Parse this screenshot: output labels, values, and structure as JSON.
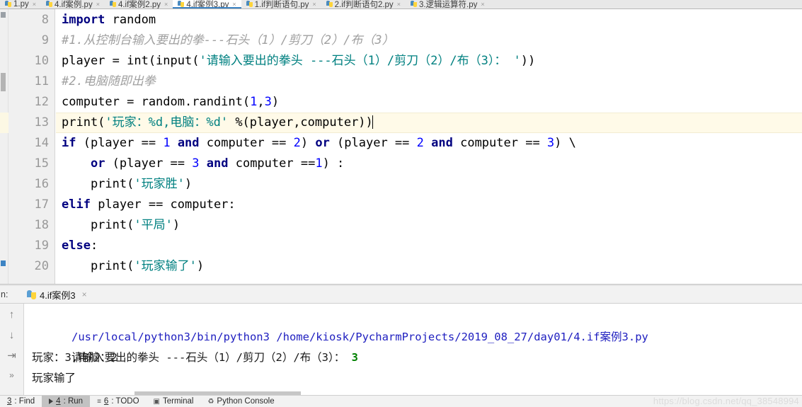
{
  "editor_tabs": [
    {
      "label": "1.py",
      "active": false
    },
    {
      "label": "4.if案例.py",
      "active": false
    },
    {
      "label": "4.if案例2.py",
      "active": false
    },
    {
      "label": "4.if案例3.py",
      "active": true
    },
    {
      "label": "1.if判断语句.py",
      "active": false
    },
    {
      "label": "2.if判断语句2.py",
      "active": false
    },
    {
      "label": "3.逻辑运算符.py",
      "active": false
    }
  ],
  "editor": {
    "first_line_number": 8,
    "current_line": 13,
    "lines": [
      {
        "n": "8",
        "text": "import random"
      },
      {
        "n": "9",
        "text": "#1.从控制台输入要出的拳---石头（1）/剪刀（2）/布（3）"
      },
      {
        "n": "10",
        "text": "player = int(input('请输入要出的拳头 ---石头（1）/剪刀（2）/布（3）： '))"
      },
      {
        "n": "11",
        "text": "#2.电脑随即出拳"
      },
      {
        "n": "12",
        "text": "computer = random.randint(1,3)"
      },
      {
        "n": "13",
        "text": "print('玩家：%d,电脑：%d' %(player,computer))"
      },
      {
        "n": "14",
        "text": "if (player == 1 and computer == 2) or (player == 2 and computer == 3) \\"
      },
      {
        "n": "15",
        "text": "    or (player == 3 and computer ==1) :"
      },
      {
        "n": "16",
        "text": "    print('玩家胜')"
      },
      {
        "n": "17",
        "text": "elif player == computer:"
      },
      {
        "n": "18",
        "text": "    print('平局')"
      },
      {
        "n": "19",
        "text": "else:"
      },
      {
        "n": "20",
        "text": "    print('玩家输了')"
      }
    ]
  },
  "run_panel": {
    "title": "n:",
    "tab_label": "4.if案例3",
    "close_glyph": "×",
    "tools": {
      "scroll_up": "↑",
      "scroll_down": "↓",
      "soft_wrap": "⇥",
      "more": "»"
    },
    "console": {
      "command": "/usr/local/python3/bin/python3 /home/kiosk/PycharmProjects/2019_08_27/day01/4.if案例3.py",
      "prompt_line": "请输入要出的拳头 ---石头（1）/剪刀（2）/布（3）： ",
      "prompt_input": "3",
      "output_line_1": "玩家：3,电脑：2",
      "output_line_2": "玩家输了"
    }
  },
  "status_bar": {
    "items": [
      {
        "num": "3",
        "label": ": Find",
        "icon": "",
        "active": false
      },
      {
        "num": "4",
        "label": ": Run",
        "icon": "play-icon",
        "active": true
      },
      {
        "num": "6",
        "label": ": TODO",
        "icon": "list-icon",
        "active": false
      },
      {
        "num": "",
        "label": "Terminal",
        "icon": "terminal-icon",
        "active": false
      },
      {
        "num": "",
        "label": "Python Console",
        "icon": "python-icon",
        "active": false
      }
    ],
    "watermark": "https://blog.csdn.net/qq_38548994"
  },
  "colors": {
    "keyword": "#000080",
    "string": "#008080",
    "number": "#0000ff",
    "comment": "#a0a0a0",
    "current_line_bg": "#fffae8",
    "accent": "#3d84c4"
  }
}
